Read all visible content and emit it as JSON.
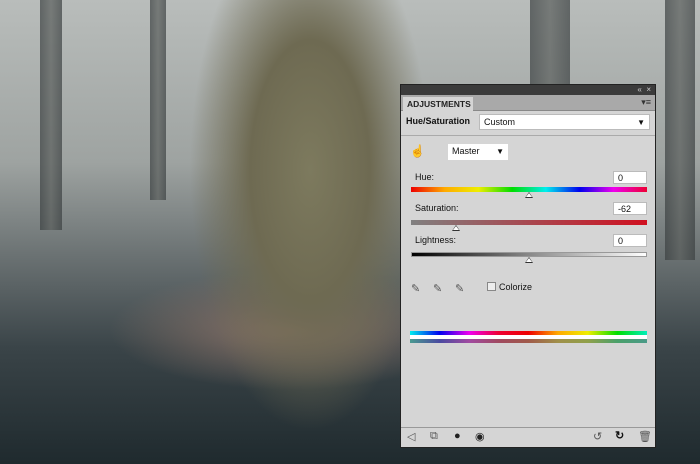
{
  "panel": {
    "tab": "ADJUSTMENTS",
    "window_controls": {
      "collapse": "«",
      "close": "×"
    },
    "menu_icon": "panel-menu-icon",
    "adjustment_name": "Hue/Saturation",
    "preset": "Custom",
    "channel": "Master",
    "sliders": [
      {
        "label": "Hue:",
        "value": "0",
        "min": -180,
        "max": 180,
        "num": 0
      },
      {
        "label": "Saturation:",
        "value": "-62",
        "min": -100,
        "max": 100,
        "num": -62
      },
      {
        "label": "Lightness:",
        "value": "0",
        "min": -100,
        "max": 100,
        "num": 0
      }
    ],
    "colorize_label": "Colorize",
    "colorize_checked": false,
    "footer_icons": [
      "back-arrow-icon",
      "clip-to-layer-icon",
      "visibility-eye-icon",
      "view-previous-icon",
      "reset-icon",
      "delete-icon"
    ]
  }
}
